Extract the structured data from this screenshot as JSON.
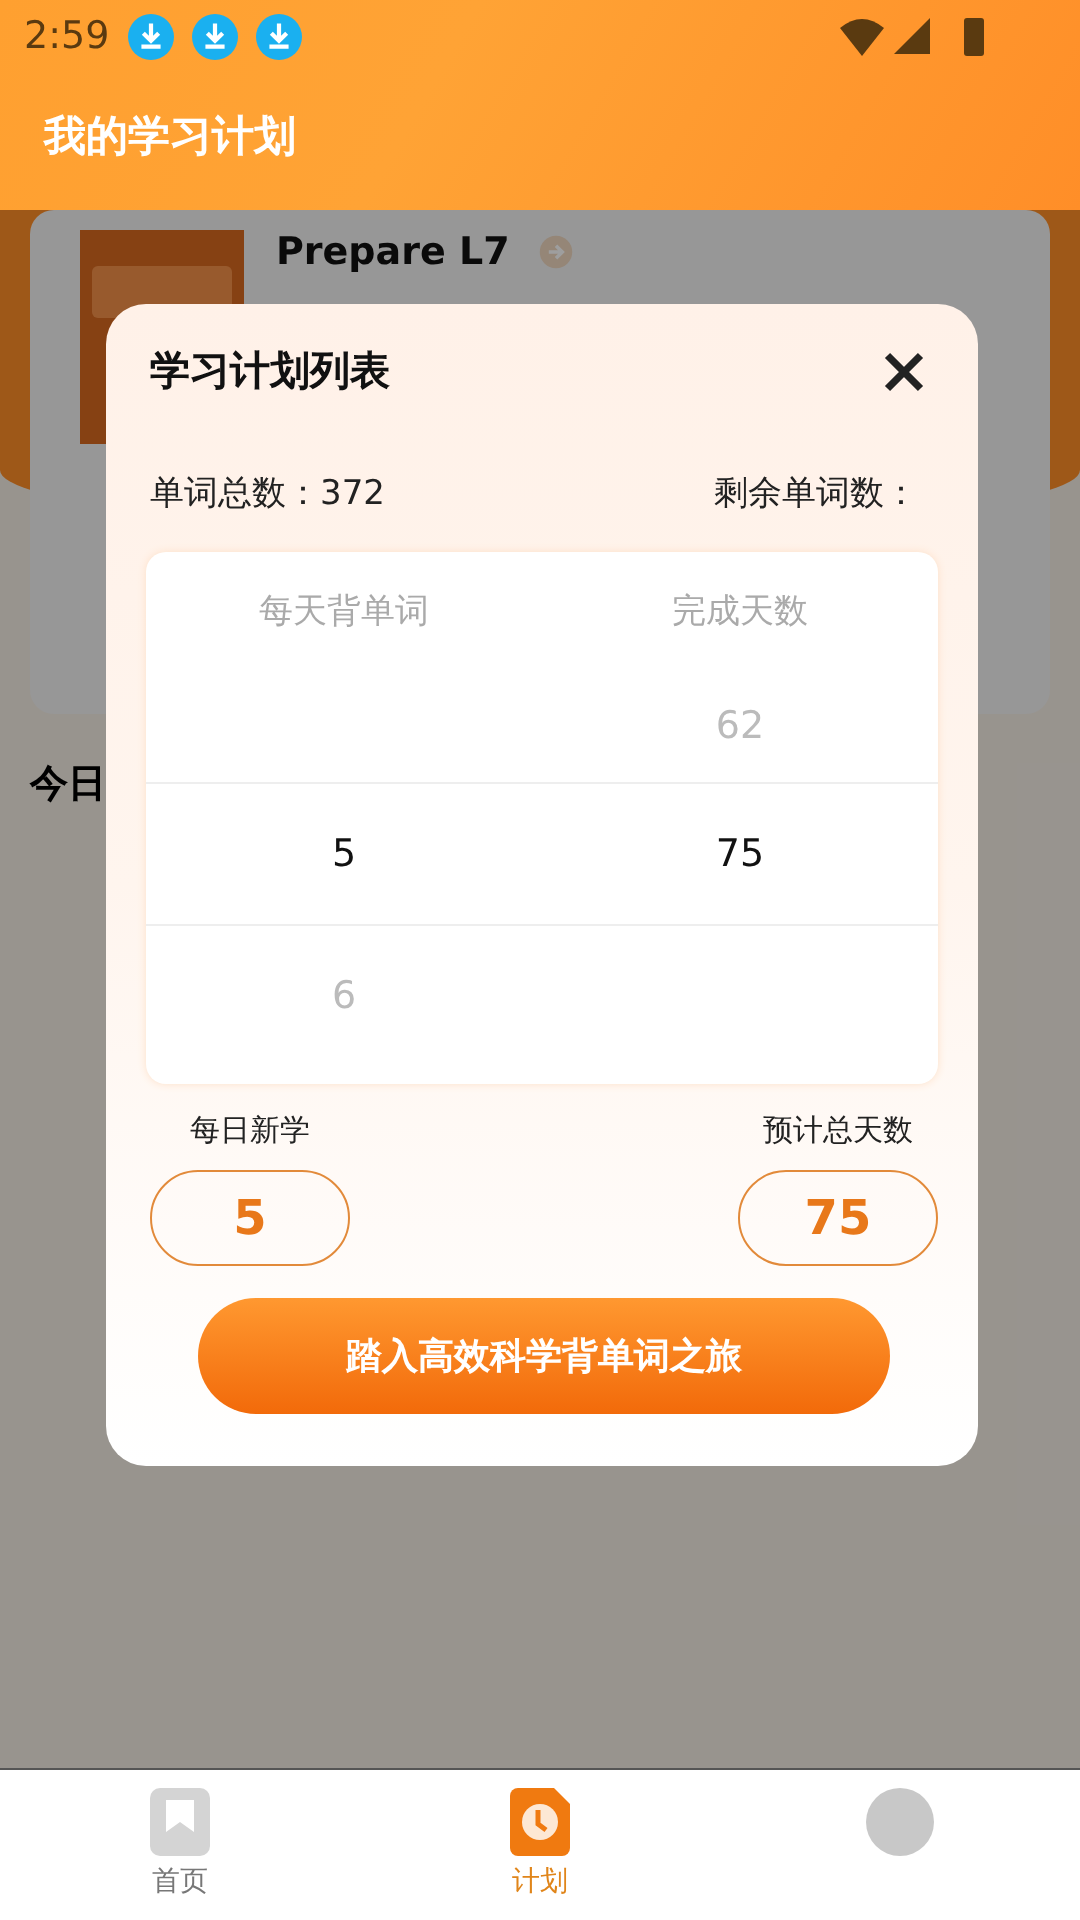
{
  "status_bar": {
    "time": "2:59",
    "notifications": [
      {
        "kind": "download"
      },
      {
        "kind": "download"
      },
      {
        "kind": "download"
      }
    ]
  },
  "header": {
    "title": "我的学习计划"
  },
  "book_card": {
    "title": "Prepare L7"
  },
  "section_title": "今日",
  "dialog": {
    "title": "学习计划列表",
    "total_label": "单词总数：372",
    "remaining_label": "剩余单词数：",
    "picker": {
      "headers": [
        "每天背单词",
        "完成天数"
      ],
      "rows": [
        {
          "selected": false,
          "days": "62"
        },
        {
          "selected": true,
          "per_day": "5",
          "days": "75"
        },
        {
          "selected": false,
          "per_day": "6"
        }
      ]
    },
    "fields": [
      {
        "label": "每日新学",
        "value": "5"
      },
      {
        "label": "预计总天数",
        "value": "75"
      }
    ],
    "button": "踏入高效科学背单词之旅"
  },
  "tabs": [
    {
      "label": "首页",
      "kind": "home",
      "selected": false
    },
    {
      "label": "计划",
      "kind": "plan",
      "selected": true
    },
    {
      "kind": "avatar",
      "selected": false
    }
  ]
}
